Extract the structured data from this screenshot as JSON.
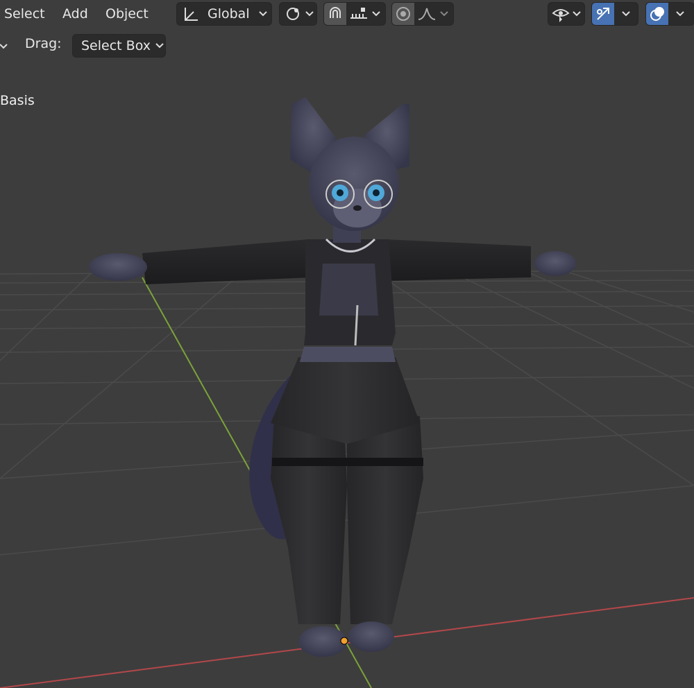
{
  "header": {
    "menu": [
      "Select",
      "Add",
      "Object"
    ],
    "orientation_label": "Global"
  },
  "toolbar": {
    "drag_label": "Drag:",
    "drag_value": "Select Box"
  },
  "viewport": {
    "shape_key_label": "Basis"
  },
  "colors": {
    "background": "#3d3d3d",
    "grid_line": "#4a4a4a",
    "x_axis": "#b4474a",
    "y_axis": "#7ba33a",
    "origin": "#f0a030",
    "active_button": "#4772b3"
  }
}
